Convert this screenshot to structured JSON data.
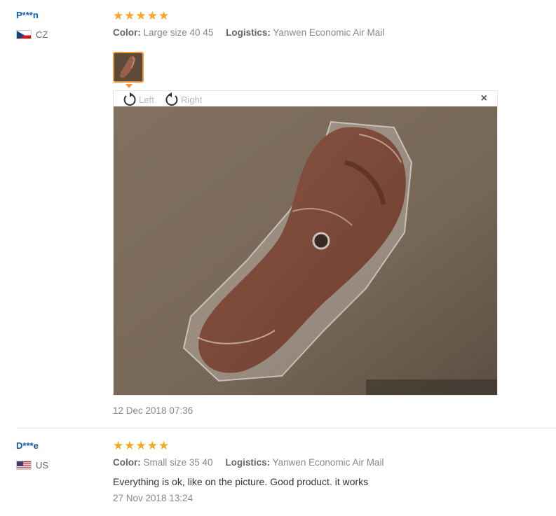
{
  "reviews": [
    {
      "user": "P***n",
      "country": "CZ",
      "rating": 5,
      "color_label": "Color:",
      "color_value": "Large size 40 45",
      "logistics_label": "Logistics:",
      "logistics_value": "Yanwen Economic Air Mail",
      "viewer": {
        "rotate_left": "Left",
        "rotate_right": "Right",
        "close": "×"
      },
      "date": "12 Dec 2018 07:36"
    },
    {
      "user": "D***e",
      "country": "US",
      "rating": 5,
      "color_label": "Color:",
      "color_value": "Small size 35 40",
      "logistics_label": "Logistics:",
      "logistics_value": "Yanwen Economic Air Mail",
      "text": "Everything is ok, like on the picture. Good product. it works",
      "date": "27 Nov 2018 13:24"
    }
  ],
  "colors": {
    "star": "#f5a623",
    "username": "#0e5da8",
    "thumb_border": "#f29a38"
  }
}
